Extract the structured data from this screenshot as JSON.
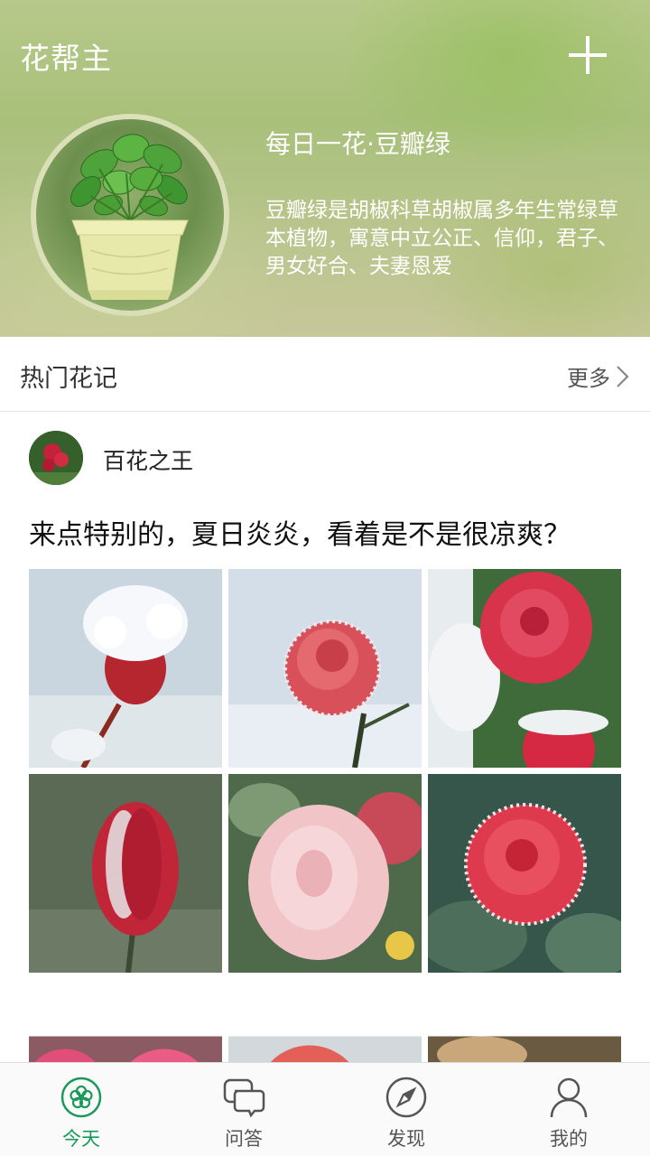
{
  "header": {
    "app_title": "花帮主",
    "add_icon": "plus-icon"
  },
  "daily_flower": {
    "title": "每日一花·豆瓣绿",
    "description": "豆瓣绿是胡椒科草胡椒属多年生常绿草本植物，寓意中立公正、信仰，君子、男女好合、夫妻恩爱"
  },
  "section": {
    "title": "热门花记",
    "more_label": "更多",
    "more_icon": "chevron-right-icon"
  },
  "post": {
    "author": "百花之王",
    "text": "来点特别的，夏日炎炎，看着是不是很凉爽？",
    "images": [
      "frosted-rose-bud-snow",
      "frosted-pink-rose",
      "red-roses-snow",
      "frosted-red-bud",
      "frosted-pale-pink-rose",
      "frosted-red-rose",
      "pink-roses-frost",
      "red-rose-frost",
      "cream-rose-frost"
    ]
  },
  "tabbar": {
    "active_color": "#1a9a5a",
    "tabs": [
      {
        "label": "今天",
        "icon": "flower-icon"
      },
      {
        "label": "问答",
        "icon": "chat-bubbles-icon"
      },
      {
        "label": "发现",
        "icon": "compass-icon"
      },
      {
        "label": "我的",
        "icon": "person-icon"
      }
    ]
  }
}
